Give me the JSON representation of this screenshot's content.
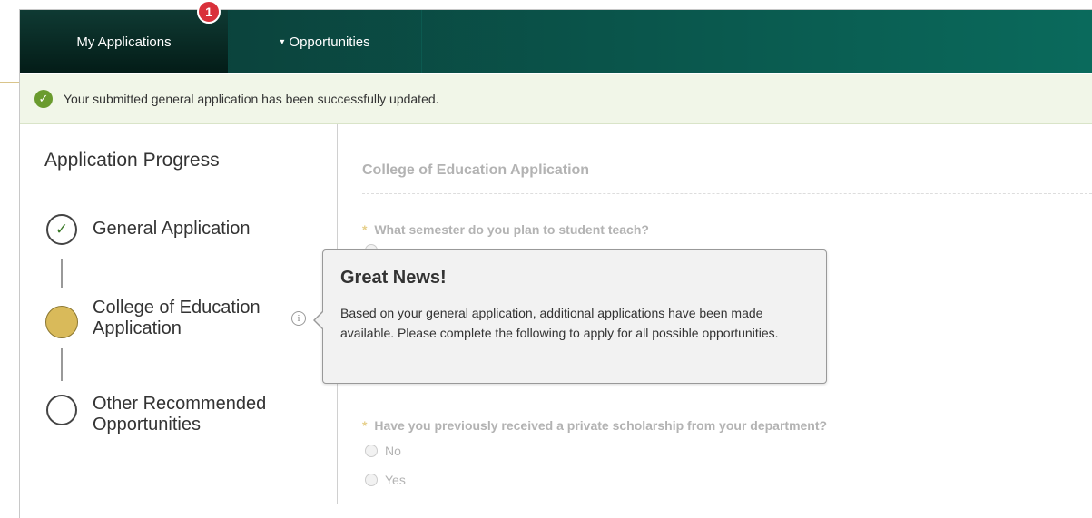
{
  "nav": {
    "tabs": [
      {
        "label": "My Applications",
        "active": true
      },
      {
        "label": "Opportunities",
        "caret": "▾"
      }
    ],
    "badge_count": "1"
  },
  "alert": {
    "icon": "check-circle-icon",
    "message": "Your submitted general application has been successfully updated.",
    "color": "#6a9b2e"
  },
  "sidebar": {
    "title": "Application Progress",
    "steps": [
      {
        "label": "General Application",
        "status": "complete"
      },
      {
        "label": "College of Education Application",
        "status": "current"
      },
      {
        "label": "Other Recommended Opportunities",
        "status": "pending"
      }
    ]
  },
  "form": {
    "title": "College of Education Application",
    "questions": [
      {
        "required": "*",
        "text": "What semester do you plan to student teach?"
      },
      {
        "required": "*",
        "text": "Have you previously received a private scholarship from your department?",
        "options": [
          "No",
          "Yes"
        ]
      }
    ]
  },
  "popover": {
    "title": "Great News!",
    "body": "Based on your general application, additional applications have been made available. Please complete the following to apply for all possible opportunities."
  },
  "colors": {
    "nav_dark": "#031c17",
    "nav_teal": "#0a6a5c",
    "badge": "#d9303a",
    "current_step": "#d9ba5a",
    "success_bg": "#f1f6e8"
  }
}
